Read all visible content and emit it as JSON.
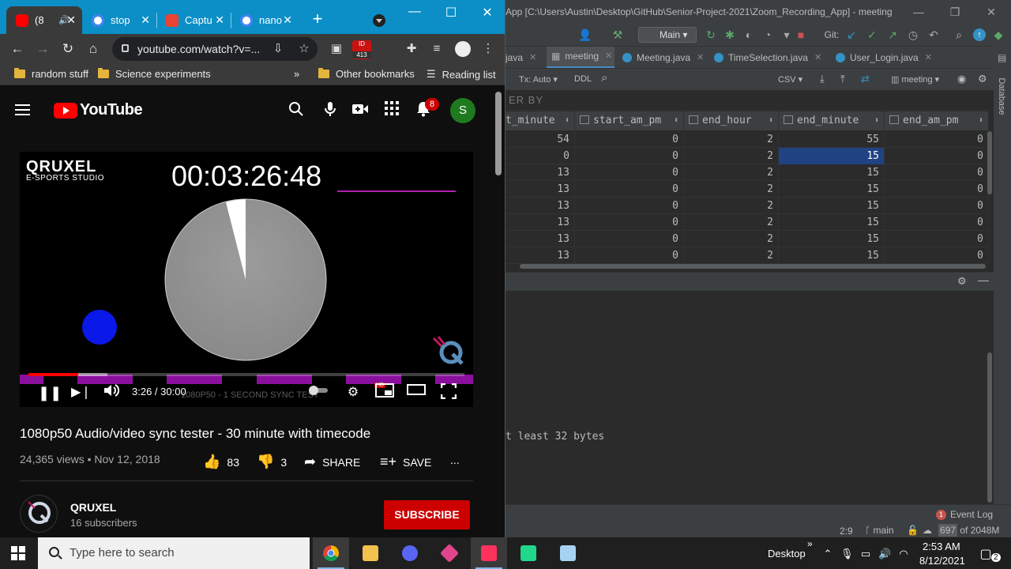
{
  "chrome": {
    "tabs": [
      {
        "title": "(8",
        "color": "#ff0000"
      },
      {
        "title": "stop",
        "color": "#ffffff"
      },
      {
        "title": "Captu",
        "color": "#ea4335"
      },
      {
        "title": "nano",
        "color": "#ffffff"
      }
    ],
    "url": "youtube.com/watch?v=...",
    "ext_badge": "413",
    "bookmarks": [
      "random stuff",
      "Science experiments",
      "Other bookmarks",
      "Reading list"
    ],
    "bookmark_overflow": "»"
  },
  "youtube": {
    "logo_text": "YouTube",
    "notifications": "8",
    "avatar_letter": "S",
    "player": {
      "brand_line1": "QRUXEL",
      "brand_line2": "E-SPORTS STUDIO",
      "timecode": "00:03:26:48",
      "time_display": "3:26 / 30:00",
      "overlay": "1080P50 - 1 SECOND SYNC TEST",
      "hd_badge": "HD",
      "progress_fraction": 0.1144
    },
    "video_title": "1080p50 Audio/video sync tester - 30 minute with timecode",
    "meta": "24,365 views • Nov 12, 2018",
    "likes": "83",
    "dislikes": "3",
    "share": "SHARE",
    "save": "SAVE",
    "more": "...",
    "channel_name": "QRUXEL",
    "subscribers": "16 subscribers",
    "subscribe": "SUBSCRIBE"
  },
  "ide": {
    "title": "App [C:\\Users\\Austin\\Desktop\\GitHub\\Senior-Project-2021\\Zoom_Recording_App] - meeting",
    "branch": "Main",
    "git_label": "Git:",
    "tabs": [
      "java",
      "meeting",
      "Meeting.java",
      "TimeSelection.java",
      "User_Login.java"
    ],
    "tx_mode": "Tx: Auto",
    "ddl": "DDL",
    "export_format": "CSV",
    "schema": "meeting",
    "order_by": "ER BY",
    "right_stripe": "Database",
    "columns": [
      "t_minute",
      "start_am_pm",
      "end_hour",
      "end_minute",
      "end_am_pm"
    ],
    "rows": [
      [
        "54",
        "0",
        "2",
        "55",
        "0"
      ],
      [
        "0",
        "0",
        "2",
        "15",
        "0"
      ],
      [
        "13",
        "0",
        "2",
        "15",
        "0"
      ],
      [
        "13",
        "0",
        "2",
        "15",
        "0"
      ],
      [
        "13",
        "0",
        "2",
        "15",
        "0"
      ],
      [
        "13",
        "0",
        "2",
        "15",
        "0"
      ],
      [
        "13",
        "0",
        "2",
        "15",
        "0"
      ],
      [
        "13",
        "0",
        "2",
        "15",
        "0"
      ]
    ],
    "console_line": "t least 32 bytes",
    "event_log": "Event Log",
    "event_count": "1",
    "cursor": "2:9",
    "vcs_branch": "main",
    "memory_used": "697",
    "memory_total": "of 2048M"
  },
  "taskbar": {
    "search_placeholder": "Type here to search",
    "desktop": "Desktop",
    "chevron": "»",
    "time": "2:53 AM",
    "date": "8/12/2021",
    "notif_count": "2"
  }
}
